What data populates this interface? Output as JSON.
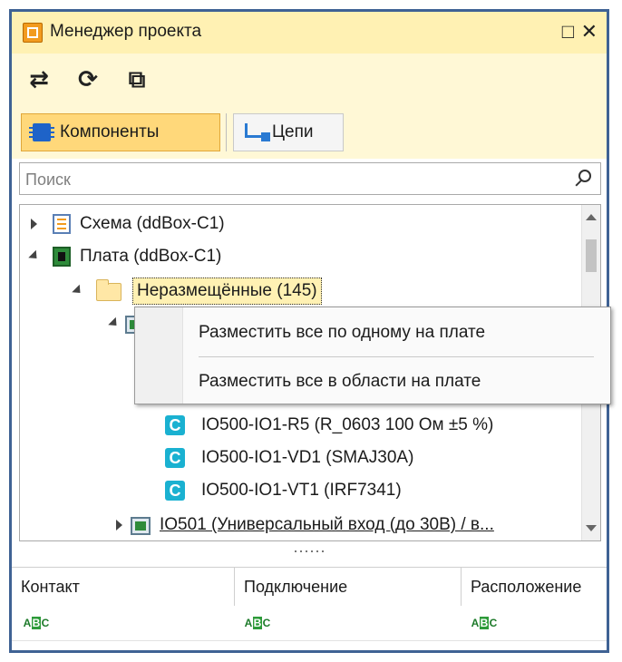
{
  "window": {
    "title": "Менеджер проекта",
    "maximize_glyph": "□",
    "close_glyph": "✕"
  },
  "toolbar": {
    "icons": [
      "swap-arrows-icon",
      "refresh-icon",
      "copy-window-icon"
    ]
  },
  "tabs": [
    {
      "label": "Компоненты",
      "active": true
    },
    {
      "label": "Цепи",
      "active": false
    }
  ],
  "search": {
    "placeholder": "Поиск"
  },
  "tree": {
    "items": [
      {
        "label": "Схема (ddBox-C1)"
      },
      {
        "label": "Плата (ddBox-C1)"
      },
      {
        "label": "Неразмещённые (145)"
      },
      {
        "label": "IO500-IO1-R5 (R_0603 100 Ом ±5 %)"
      },
      {
        "label": "IO500-IO1-VD1 (SMAJ30A)"
      },
      {
        "label": "IO500-IO1-VT1 (IRF7341)"
      },
      {
        "label": "IO501 (Универсальный вход (до 30В) / в..."
      }
    ]
  },
  "context_menu": {
    "items": [
      {
        "label": "Разместить все по одному на плате"
      },
      {
        "label": "Разместить все в области на плате"
      }
    ]
  },
  "grid": {
    "columns": [
      "Контакт",
      "Подключение",
      "Расположение"
    ],
    "row_icon_text": [
      "A",
      "B",
      "C"
    ]
  },
  "colors": {
    "accent": "#ffd87a",
    "titlebar": "#fff1b3",
    "frame": "#3f6294"
  }
}
